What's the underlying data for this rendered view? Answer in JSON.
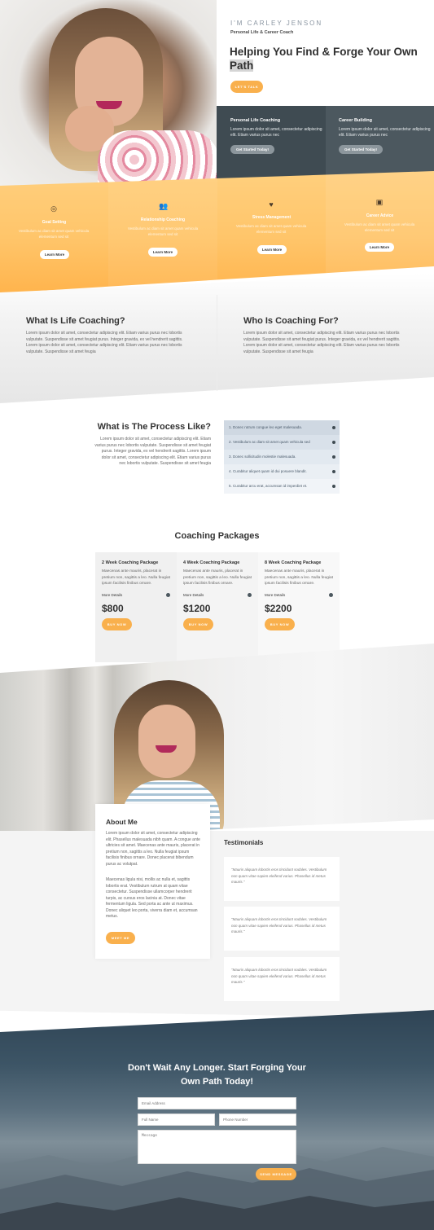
{
  "hero": {
    "eyebrow": "I'M CARLEY JENSON",
    "subtitle": "Personal Life & Career Coach",
    "title_part1": "Helping You Find & Forge Your Own",
    "title_highlight": "Path",
    "button": "LET'S TALK"
  },
  "services_dark": [
    {
      "title": "Personal Life Coaching",
      "text": "Lorem ipsum dolor sit amet, consectetur adipiscing elit. Etiam varius purus nec",
      "button": "Get Started Today!"
    },
    {
      "title": "Career Building",
      "text": "Lorem ipsum dolor sit amet, consectetur adipiscing elit. Etiam varius purus nec",
      "button": "Get Started Today!"
    }
  ],
  "services_orange": [
    {
      "icon": "target-icon",
      "title": "Goal Setting",
      "text": "Vestibulum ac diam sit amet quam vehicula elementum sed sit",
      "button": "Learn More"
    },
    {
      "icon": "users-icon",
      "title": "Relationship Coaching",
      "text": "Vestibulum ac diam sit amet quam vehicula elementum sed sit",
      "button": "Learn More"
    },
    {
      "icon": "heart-icon",
      "title": "Stress Management",
      "text": "Vestibulum ac diam sit amet quam vehicula elementum sed sit",
      "button": "Learn More"
    },
    {
      "icon": "briefcase-icon",
      "title": "Career Advice",
      "text": "Vestibulum ac diam sit amet quam vehicula elementum sed sit",
      "button": "Learn More"
    }
  ],
  "life": {
    "title": "What Is Life Coaching?",
    "text": "Lorem ipsum dolor sit amet, consectetur adipiscing elit. Etiam varius purus nec lobortis vulputate. Suspendisse sit amet feugiat purus. Integer gravida, ex vel hendrerit sagittis. Lorem ipsum dolor sit amet, consectetur adipiscing elit. Etiam varius purus nec lobortis vulputate. Suspendisse sit amet feugia"
  },
  "who": {
    "title": "Who Is Coaching For?",
    "text": "Lorem ipsum dolor sit amet, consectetur adipiscing elit. Etiam varius purus nec lobortis vulputate. Suspendisse sit amet feugiat purus. Integer gravida, ex vel hendrerit sagittis. Lorem ipsum dolor sit amet, consectetur adipiscing elit. Etiam varius purus nec lobortis vulputate. Suspendisse sit amet feugia"
  },
  "process": {
    "title": "What is The Process Like?",
    "text": "Lorem ipsum dolor sit amet, consectetur adipiscing elit. Etiam varius purus nec lobortis vulputate. Suspendisse sit amet feugiat purus. Integer gravida, ex vel hendrerit sagittis. Lorem ipsum dolor sit amet, consectetur adipiscing elit. Etiam varius purus nec lobortis vulputate. Suspendisse sit amet feugia",
    "items": [
      {
        "label": "1. Donec rutrum congue leo eget malesuada.",
        "bg": "#cfd8e2"
      },
      {
        "label": "2. Vestibulum ac diam sit amet quam vehicula sed",
        "bg": "#d9e1ea"
      },
      {
        "label": "3. Donec sollicitudin molestie malesuada.",
        "bg": "#e2e9f0"
      },
      {
        "label": "4. Curabitur aliquet quam id dui posuere blandit.",
        "bg": "#eaeff4"
      },
      {
        "label": "5. Curabitur arcu erat, accumsan id imperdiet et.",
        "bg": "#f1f4f8"
      }
    ]
  },
  "packages": {
    "title": "Coaching Packages",
    "items": [
      {
        "title": "2 Week Coaching Package",
        "text": "Maecenas ante mauris, placerat in pretium non, sagittis a leo. Nulla feugiat ipsum facilisis finibus ornare.",
        "more": "More Details",
        "price": "$800",
        "button": "BUY NOW",
        "bg": "#f0f0f0"
      },
      {
        "title": "4 Week Coaching Package",
        "text": "Maecenas ante mauris, placerat in pretium non, sagittis a leo. Nulla feugiat ipsum facilisis finibus ornare.",
        "more": "More Details",
        "price": "$1200",
        "button": "BUY NOW",
        "bg": "#f4f4f4"
      },
      {
        "title": "8 Week Coaching Package",
        "text": "Maecenas ante mauris, placerat in pretium non, sagittis a leo. Nulla feugiat ipsum facilisis finibus ornare.",
        "more": "More Details",
        "price": "$2200",
        "button": "BUY NOW",
        "bg": "#f8f8f8"
      }
    ]
  },
  "about": {
    "title": "About Me",
    "para1": "Lorem ipsum dolor sit amet, consectetur adipiscing elit. Phasellus malesuada nibh quam. A congue ante ultricies sit amet. Maecenas ante mauris, placerat in pretium non, sagittis a leo. Nulla feugiat ipsum facilisis finibus ornare. Donec placerat bibendum purus ac volutpat.",
    "para2": "Maecenas ligula nisi, mollis ac nulla et, sagittis lobortis erat. Vestibulum rutrum at quam vitae consectetur. Suspendisse ullamcorper hendrerit turpis, ac cursus eros lacinia at. Donec vitae fermentum ligula. Sed porta ac ante ut maximus. Donec aliquet leo porta, viverra diam et, accumsan metus.",
    "button": "MEET ME"
  },
  "testimonials": {
    "title": "Testimonials",
    "items": [
      "\"Mauris aliquam lobortis eros tincidunt sodales. Vestibulum non quam vitae sapien eleifend varius. Phasellus id metus mauris.\"",
      "\"Mauris aliquam lobortis eros tincidunt sodales. Vestibulum non quam vitae sapien eleifend varius. Phasellus id metus mauris.\"",
      "\"Mauris aliquam lobortis eros tincidunt sodales. Vestibulum non quam vitae sapien eleifend varius. Phasellus id metus mauris.\""
    ]
  },
  "cta": {
    "title": "Don't Wait Any Longer. Start Forging Your Own Path Today!",
    "email_placeholder": "Email Address",
    "name_placeholder": "Full Name",
    "phone_placeholder": "Phone Number",
    "message_placeholder": "Message",
    "button": "SEND MESSAGE"
  },
  "colors": {
    "accent_orange": "#f9b04d",
    "dark_slate": "#3f4b52",
    "text_dark": "#333333"
  }
}
